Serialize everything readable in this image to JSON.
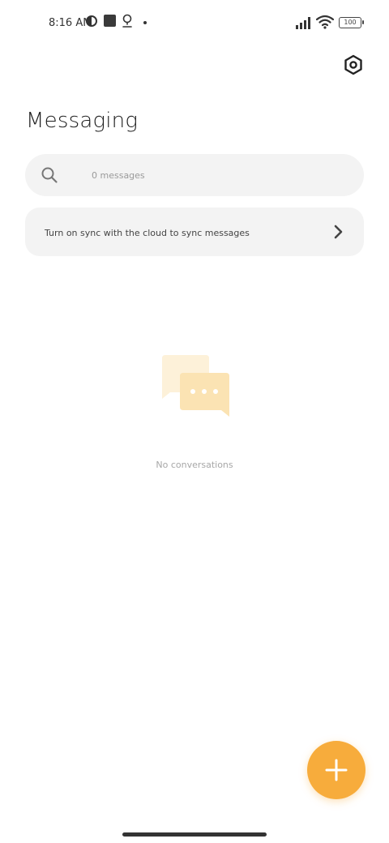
{
  "status_bar": {
    "time": "8:16 AM",
    "battery": "100",
    "icons": [
      "contrast-icon",
      "square-icon",
      "location-pin-icon",
      "dot-icon",
      "signal-icon",
      "wifi-icon",
      "battery-icon"
    ]
  },
  "header": {
    "title": "Messaging",
    "settings_icon": "settings-hexagon-icon"
  },
  "search": {
    "placeholder": "0 messages",
    "icon": "search-icon"
  },
  "sync_banner": {
    "text": "Turn on sync with the cloud to sync messages",
    "icon": "chevron-right-icon"
  },
  "empty_state": {
    "text": "No conversations",
    "icon": "chat-bubbles-icon"
  },
  "fab": {
    "icon": "plus-icon"
  },
  "colors": {
    "accent": "#f7ac3c",
    "surface": "#f3f3f3",
    "bubble_light": "#fdf1d9",
    "bubble_dark": "#fbe3b3"
  }
}
